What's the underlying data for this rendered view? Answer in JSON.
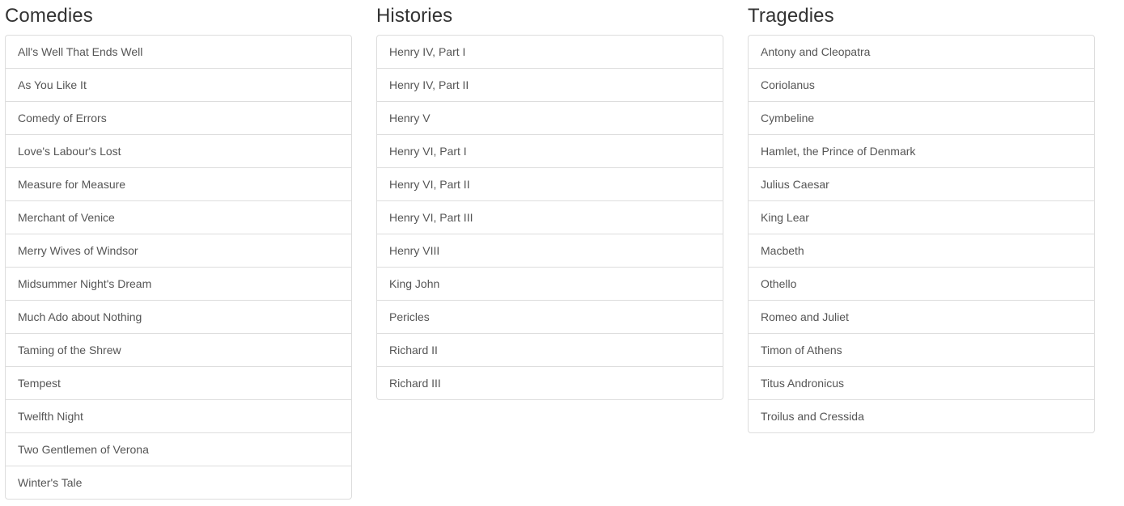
{
  "columns": [
    {
      "title": "Comedies",
      "items": [
        "All's Well That Ends Well",
        "As You Like It",
        "Comedy of Errors",
        "Love's Labour's Lost",
        "Measure for Measure",
        "Merchant of Venice",
        "Merry Wives of Windsor",
        "Midsummer Night's Dream",
        "Much Ado about Nothing",
        "Taming of the Shrew",
        "Tempest",
        "Twelfth Night",
        "Two Gentlemen of Verona",
        "Winter's Tale"
      ]
    },
    {
      "title": "Histories",
      "items": [
        "Henry IV, Part I",
        "Henry IV, Part II",
        "Henry V",
        "Henry VI, Part I",
        "Henry VI, Part II",
        "Henry VI, Part III",
        "Henry VIII",
        "King John",
        "Pericles",
        "Richard II",
        "Richard III"
      ]
    },
    {
      "title": "Tragedies",
      "items": [
        "Antony and Cleopatra",
        "Coriolanus",
        "Cymbeline",
        "Hamlet, the Prince of Denmark",
        "Julius Caesar",
        "King Lear",
        "Macbeth",
        "Othello",
        "Romeo and Juliet",
        "Timon of Athens",
        "Titus Andronicus",
        "Troilus and Cressida"
      ]
    }
  ],
  "colors": {
    "heading": "#333333",
    "item_text": "#555555",
    "border": "#dddddd",
    "background": "#ffffff"
  }
}
